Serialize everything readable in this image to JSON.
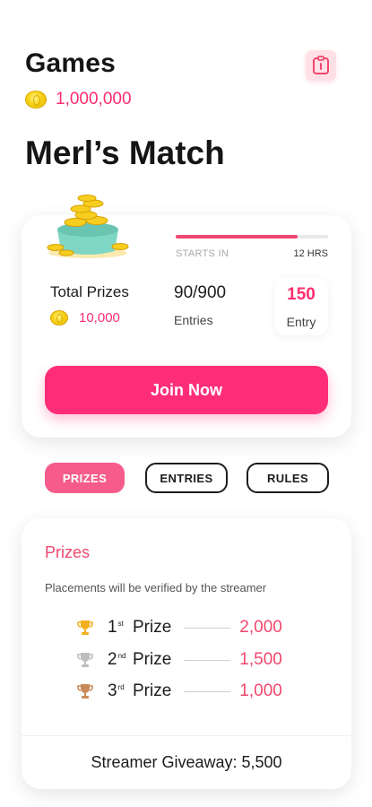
{
  "header": {
    "title": "Games",
    "coin_icon": "coin-icon",
    "balance": "1,000,000",
    "profile_icon": "profile-card-icon"
  },
  "game": {
    "name": "Merl’s Match"
  },
  "card": {
    "progress": {
      "fraction": 0.8,
      "starts_label": "STARTS IN",
      "time_remaining": "12 HRS"
    },
    "total_prizes": {
      "label": "Total Prizes",
      "value": "10,000"
    },
    "entries": {
      "count": "90/900",
      "label": "Entries"
    },
    "entry_fee": {
      "value": "150",
      "label": "Entry"
    },
    "join_button": "Join Now"
  },
  "tabs": [
    {
      "label": "PRIZES",
      "active": true
    },
    {
      "label": "ENTRIES",
      "active": false
    },
    {
      "label": "RULES",
      "active": false
    }
  ],
  "prizes": {
    "heading": "Prizes",
    "note": "Placements will be verified by the streamer",
    "places": [
      {
        "rank": "1",
        "suffix": "st",
        "label": "Prize",
        "value": "2,000",
        "trophy": "gold-trophy-icon"
      },
      {
        "rank": "2",
        "suffix": "nd",
        "label": "Prize",
        "value": "1,500",
        "trophy": "silver-trophy-icon"
      },
      {
        "rank": "3",
        "suffix": "rd",
        "label": "Prize",
        "value": "1,000",
        "trophy": "bronze-trophy-icon"
      }
    ],
    "giveaway": "Streamer Giveaway: 5,500"
  },
  "colors": {
    "accent": "#ff2d6f",
    "trophy_gold": "#f2b01e",
    "trophy_silver": "#bdbdbd",
    "trophy_bronze": "#c98a5a"
  }
}
